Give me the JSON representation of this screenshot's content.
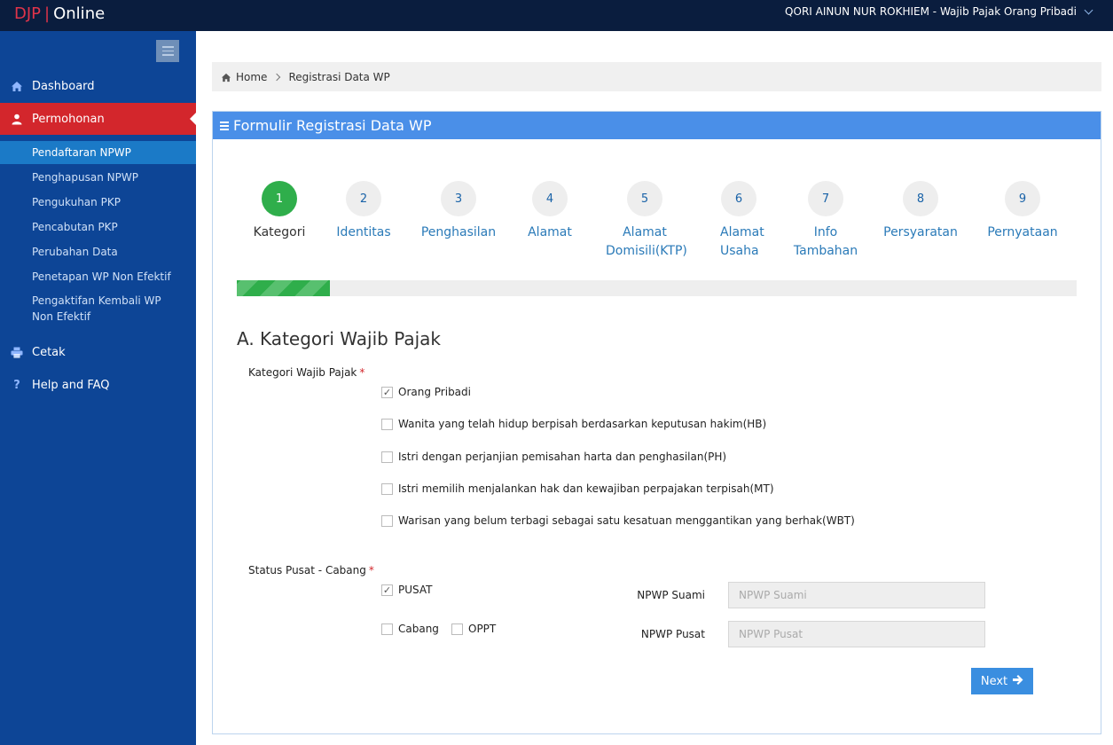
{
  "topbar": {
    "brand_djp": "DJP",
    "brand_sep": "|",
    "brand_online": "Online",
    "user_label": "QORI AINUN NUR ROKHIEM - Wajib Pajak Orang Pribadi"
  },
  "sidebar": {
    "items": [
      {
        "label": "Dashboard",
        "icon": "home-icon"
      },
      {
        "label": "Permohonan",
        "icon": "user-icon"
      },
      {
        "label": "Cetak",
        "icon": "print-icon"
      },
      {
        "label": "Help and FAQ",
        "icon": "question-icon"
      }
    ],
    "sub_items": [
      "Pendaftaran NPWP",
      "Penghapusan NPWP",
      "Pengukuhan PKP",
      "Pencabutan PKP",
      "Perubahan Data",
      "Penetapan WP Non Efektif",
      "Pengaktifan Kembali WP Non Efektif"
    ]
  },
  "breadcrumb": {
    "home": "Home",
    "current": "Registrasi Data WP"
  },
  "panel": {
    "title": "Formulir Registrasi Data WP"
  },
  "steps": [
    {
      "num": "1",
      "label": "Kategori"
    },
    {
      "num": "2",
      "label": "Identitas"
    },
    {
      "num": "3",
      "label": "Penghasilan"
    },
    {
      "num": "4",
      "label": "Alamat"
    },
    {
      "num": "5",
      "label": "Alamat Domisili(KTP)"
    },
    {
      "num": "6",
      "label": "Alamat Usaha"
    },
    {
      "num": "7",
      "label": "Info Tambahan"
    },
    {
      "num": "8",
      "label": "Persyaratan"
    },
    {
      "num": "9",
      "label": "Pernyataan"
    }
  ],
  "progress": {
    "fraction": 0.111
  },
  "form": {
    "section_title": "A. Kategori Wajib Pajak",
    "kategori_label": "Kategori Wajib Pajak",
    "required_mark": "*",
    "kategori_options": [
      {
        "label": "Orang Pribadi",
        "checked": true
      },
      {
        "label": "Wanita yang telah hidup berpisah berdasarkan keputusan hakim(HB)",
        "checked": false
      },
      {
        "label": "Istri dengan perjanjian pemisahan harta dan penghasilan(PH)",
        "checked": false
      },
      {
        "label": "Istri memilih menjalankan hak dan kewajiban perpajakan terpisah(MT)",
        "checked": false
      },
      {
        "label": "Warisan yang belum terbagi sebagai satu kesatuan menggantikan yang berhak(WBT)",
        "checked": false
      }
    ],
    "status_label": "Status Pusat - Cabang",
    "status_options": [
      {
        "label": "PUSAT",
        "checked": true
      },
      {
        "label": "Cabang",
        "checked": false
      },
      {
        "label": "OPPT",
        "checked": false
      }
    ],
    "npwp_suami_label": "NPWP Suami",
    "npwp_suami_placeholder": "NPWP Suami",
    "npwp_pusat_label": "NPWP Pusat",
    "npwp_pusat_placeholder": "NPWP Pusat",
    "next_label": "Next"
  }
}
